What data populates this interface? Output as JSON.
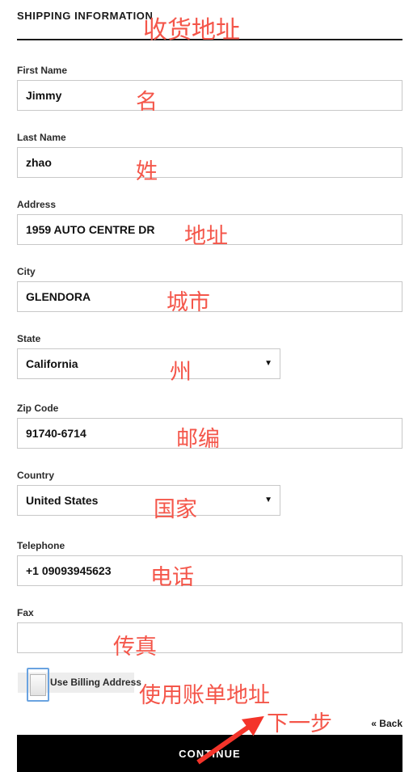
{
  "header": {
    "title": "SHIPPING INFORMATION",
    "annotation": "收货地址"
  },
  "form": {
    "fields": [
      {
        "label": "First Name",
        "value": "Jimmy",
        "placeholder": "",
        "type": "text",
        "annotation": "名"
      },
      {
        "label": "Last Name",
        "value": "zhao",
        "placeholder": "",
        "type": "text",
        "annotation": "姓"
      },
      {
        "label": "Address",
        "value": "1959 AUTO CENTRE DR",
        "placeholder": "",
        "type": "text",
        "annotation": "地址"
      },
      {
        "label": "City",
        "value": "GLENDORA",
        "placeholder": "",
        "type": "text",
        "annotation": "城市"
      },
      {
        "label": "State",
        "value": "California",
        "placeholder": "",
        "type": "select",
        "annotation": "州"
      },
      {
        "label": "Zip Code",
        "value": "91740-6714",
        "placeholder": "",
        "type": "text",
        "annotation": "邮编"
      },
      {
        "label": "Country",
        "value": "United States",
        "placeholder": "",
        "type": "select",
        "annotation": "国家"
      },
      {
        "label": "Telephone",
        "value": "+1 09093945623",
        "placeholder": "",
        "type": "text",
        "annotation": "电话"
      },
      {
        "label": "Fax",
        "value": "",
        "placeholder": "",
        "type": "text",
        "annotation": "传真"
      }
    ],
    "checkbox": {
      "label": "Use Billing Address",
      "checked": false,
      "annotation": "使用账单地址"
    }
  },
  "actions": {
    "continue_label": "CONTINUE",
    "continue_annotation": "下一步",
    "back_label": "« Back"
  },
  "icons": {
    "select_caret": "▼"
  },
  "colors": {
    "annotation_red": "#f4564a",
    "button_background": "#000000",
    "button_text": "#ffffff",
    "input_border": "#c8c8c8",
    "focus_ring": "#6aa3e0"
  }
}
